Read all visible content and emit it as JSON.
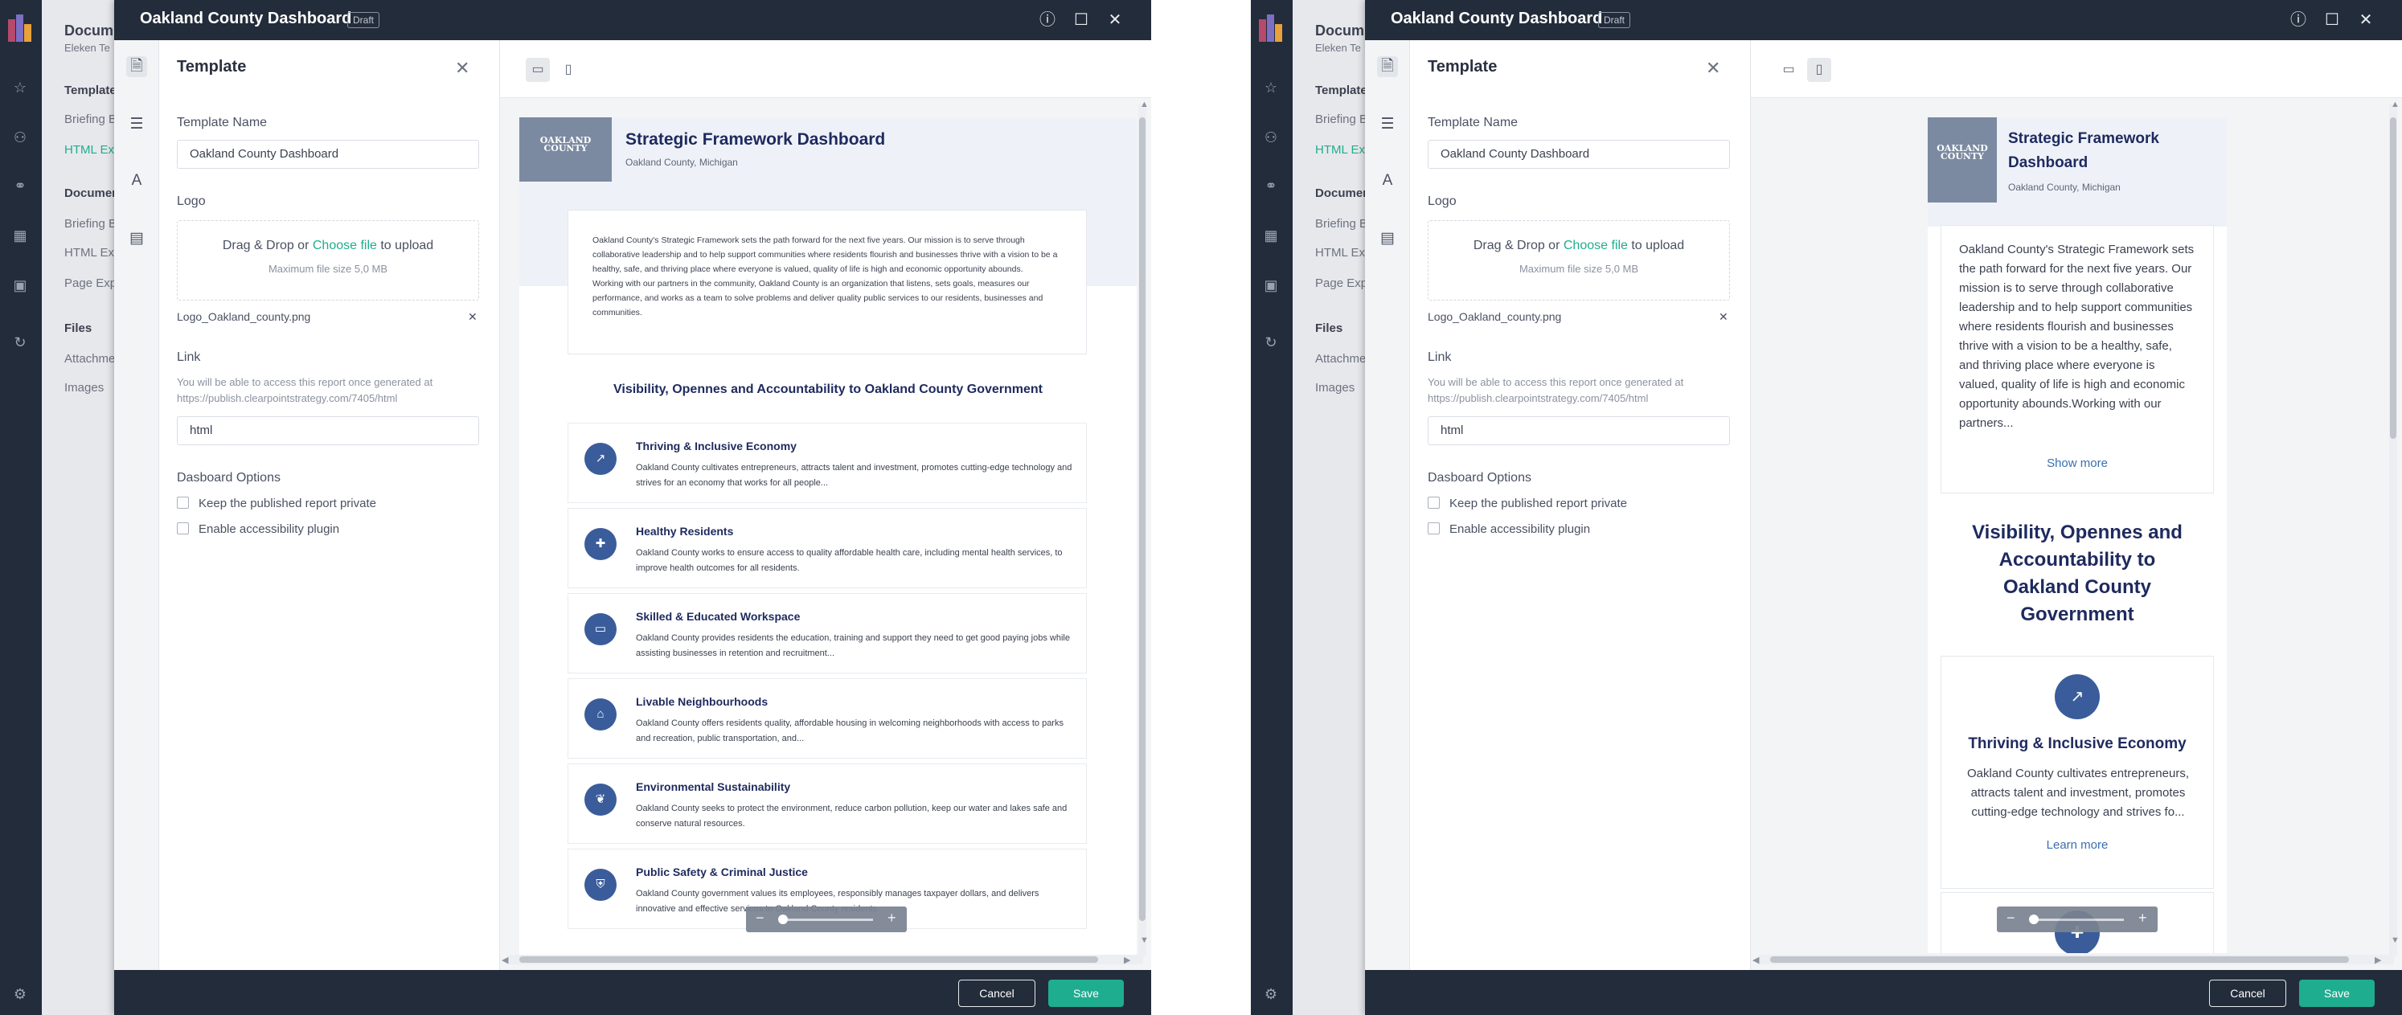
{
  "app": {
    "background_panel": {
      "title": "Docum",
      "subtitle": "Eleken Te",
      "templates_heading": "Template",
      "items1": [
        "Briefing B",
        "HTML Ex"
      ],
      "documents_heading": "Documen",
      "items2": [
        "Briefing B",
        "HTML Ex",
        "Page Exp"
      ],
      "files_heading": "Files",
      "files_items": [
        "Attachme",
        "Images"
      ]
    }
  },
  "modal": {
    "title": "Oakland County Dashboard",
    "status_badge": "Draft",
    "footer": {
      "cancel": "Cancel",
      "save": "Save"
    }
  },
  "form": {
    "title": "Template",
    "template_name_label": "Template Name",
    "template_name_value": "Oakland County Dashboard",
    "logo_label": "Logo",
    "drop_prefix": "Drag & Drop or ",
    "drop_link": "Choose file",
    "drop_suffix": " to upload",
    "drop_limit": "Maximum file size 5,0 MB",
    "logo_file": "Logo_Oakland_county.png",
    "link_label": "Link",
    "link_hint": "You will be able to access this report once generated at https://publish.clearpointstrategy.com/7405/html",
    "link_value": "html",
    "options_label": "Dasboard Options",
    "option_private": "Keep the published report private",
    "option_accessibility": "Enable accessibility plugin"
  },
  "report": {
    "logo_text": "OAKLAND COUNTY",
    "title": "Strategic Framework Dashboard",
    "location": "Oakland County, Michigan",
    "intro_p1": "Oakland County's Strategic Framework sets the path forward for the next five years. Our mission is to serve through collaborative leadership and to help support communities where residents flourish and businesses thrive with a vision to be a healthy, safe, and thriving place where everyone is valued, quality of life is high and economic opportunity abounds.",
    "intro_p2": "Working with our partners in the community, Oakland County is an organization that listens, sets goals, measures our performance, and works as a team to solve problems and deliver quality public services to our residents, businesses and communities.",
    "intro_truncated": "Oakland County's Strategic Framework sets the path forward for the next five years. Our mission is to serve through collaborative leadership and to help support communities where residents flourish and businesses thrive with a vision to be a healthy, safe, and thriving place where everyone is valued, quality of life is high and economic opportunity abounds.Working with our partners...",
    "show_more": "Show more",
    "section_title": "Visibility, Opennes and Accountability to Oakland County Government",
    "learn_more": "Learn more",
    "goals": [
      {
        "icon": "chart-line-icon",
        "glyph": "↗",
        "title": "Thriving & Inclusive Economy",
        "desc": "Oakland County cultivates entrepreneurs, attracts talent and investment, promotes cutting-edge technology and strives for an economy that works for all people...",
        "mobile_desc": "Oakland County cultivates entrepreneurs, attracts talent and investment, promotes cutting-edge technology and strives fo..."
      },
      {
        "icon": "health-cross-icon",
        "glyph": "✚",
        "title": "Healthy Residents",
        "desc": "Oakland County works to ensure access to quality affordable health care, including mental health services, to improve health outcomes for all residents."
      },
      {
        "icon": "book-icon",
        "glyph": "▭",
        "title": "Skilled & Educated Workspace",
        "desc": "Oakland County provides residents the education, training and support they need to get good paying jobs while assisting businesses in retention and recruitment..."
      },
      {
        "icon": "house-icon",
        "glyph": "⌂",
        "title": "Livable Neighbourhoods",
        "desc": "Oakland County offers residents quality, affordable housing in welcoming neighborhoods with access to parks and recreation, public transportation, and..."
      },
      {
        "icon": "leaf-icon",
        "glyph": "❦",
        "title": "Environmental Sustainability",
        "desc": "Oakland County seeks to protect the environment, reduce carbon pollution, keep our water and lakes safe and conserve natural resources."
      },
      {
        "icon": "shield-icon",
        "glyph": "⛨",
        "title": "Public Safety & Criminal Justice",
        "desc": "Oakland County government values its employees, responsibly manages taxpayer dollars, and delivers innovative and effective services to Oakland County residents."
      }
    ]
  },
  "zoom": {
    "minus": "−",
    "plus": "+"
  }
}
